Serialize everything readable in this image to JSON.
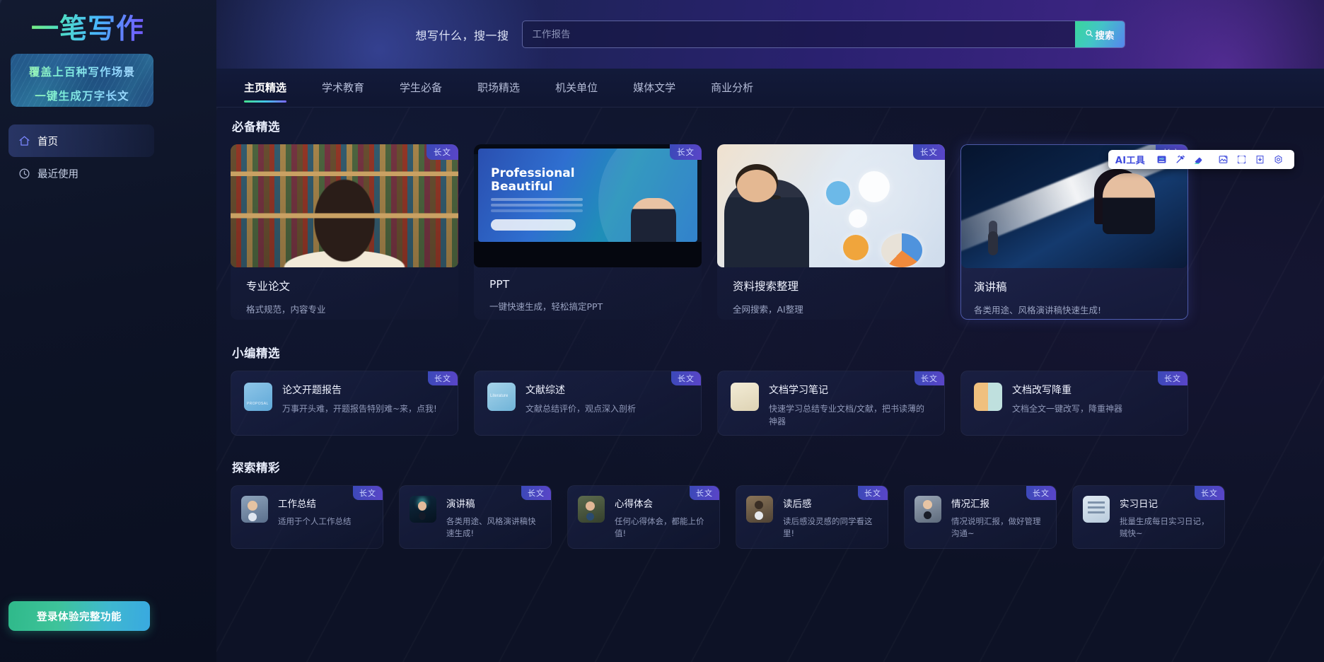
{
  "sidebar": {
    "logo": "一笔写作",
    "promo": {
      "line1": "覆盖上百种写作场景",
      "line2": "一键生成万字长文"
    },
    "nav": [
      {
        "label": "首页",
        "icon": "home-icon",
        "active": true
      },
      {
        "label": "最近使用",
        "icon": "clock-icon",
        "active": false
      }
    ],
    "login_button": "登录体验完整功能"
  },
  "header": {
    "search_label": "想写什么，搜一搜",
    "search_placeholder": "工作报告",
    "search_button": "搜索",
    "accent": "#3ad69a"
  },
  "tabs": [
    {
      "label": "主页精选",
      "active": true
    },
    {
      "label": "学术教育",
      "active": false
    },
    {
      "label": "学生必备",
      "active": false
    },
    {
      "label": "职场精选",
      "active": false
    },
    {
      "label": "机关单位",
      "active": false
    },
    {
      "label": "媒体文学",
      "active": false
    },
    {
      "label": "商业分析",
      "active": false
    }
  ],
  "ai_toolbar": {
    "label": "AI工具",
    "buttons": [
      {
        "name": "hd-icon",
        "title": "HD"
      },
      {
        "name": "magic-wand-icon",
        "title": "魔法棒"
      },
      {
        "name": "eraser-icon",
        "title": "橡皮擦"
      },
      {
        "name": "image-edit-icon",
        "title": "图片编辑"
      },
      {
        "name": "crop-icon",
        "title": "裁剪"
      },
      {
        "name": "download-icon",
        "title": "下载"
      },
      {
        "name": "settings-icon",
        "title": "设置"
      }
    ]
  },
  "sections": [
    {
      "title": "必备精选",
      "type": "featured",
      "cards": [
        {
          "title": "专业论文",
          "desc": "格式规范，内容专业",
          "badge": "长文",
          "art": "art-library",
          "selected": false
        },
        {
          "title": "PPT",
          "desc": "一键快速生成，轻松搞定PPT",
          "badge": "长文",
          "art": "art-ppt",
          "selected": false
        },
        {
          "title": "资料搜索整理",
          "desc": "全网搜索，AI整理",
          "badge": "长文",
          "art": "art-data",
          "selected": false
        },
        {
          "title": "演讲稿",
          "desc": "各类用途、风格演讲稿快速生成!",
          "badge": "长文",
          "art": "art-speech",
          "selected": true
        }
      ]
    },
    {
      "title": "小编精选",
      "type": "editor",
      "cards": [
        {
          "title": "论文开题报告",
          "desc": "万事开头难，开题报告特别难~来，点我!",
          "badge": "长文",
          "icon": "ic-proposal"
        },
        {
          "title": "文献综述",
          "desc": "文献总结评价，观点深入剖析",
          "badge": "长文",
          "icon": "ic-literature"
        },
        {
          "title": "文档学习笔记",
          "desc": "快速学习总结专业文档/文献，把书读薄的神器",
          "badge": "长文",
          "icon": "ic-notes"
        },
        {
          "title": "文档改写降重",
          "desc": "文档全文一键改写，降重神器",
          "badge": "长文",
          "icon": "ic-rewrite"
        }
      ]
    },
    {
      "title": "探索精彩",
      "type": "explore",
      "cards": [
        {
          "title": "工作总结",
          "desc": "适用于个人工作总结",
          "badge": "长文",
          "icon": "ic-work"
        },
        {
          "title": "演讲稿",
          "desc": "各类用途、风格演讲稿快速生成!",
          "badge": "长文",
          "icon": "ic-speech2"
        },
        {
          "title": "心得体会",
          "desc": "任何心得体会，都能上价值!",
          "badge": "长文",
          "icon": "ic-insight"
        },
        {
          "title": "读后感",
          "desc": "读后感没灵感的同学看这里!",
          "badge": "长文",
          "icon": "ic-read"
        },
        {
          "title": "情况汇报",
          "desc": "情况说明汇报，做好管理沟通~",
          "badge": "长文",
          "icon": "ic-report"
        },
        {
          "title": "实习日记",
          "desc": "批量生成每日实习日记，贼快~",
          "badge": "长文",
          "icon": "ic-diary"
        }
      ]
    }
  ],
  "ppt_art": {
    "heading_line1": "Professional",
    "heading_line2": "Beautiful"
  }
}
